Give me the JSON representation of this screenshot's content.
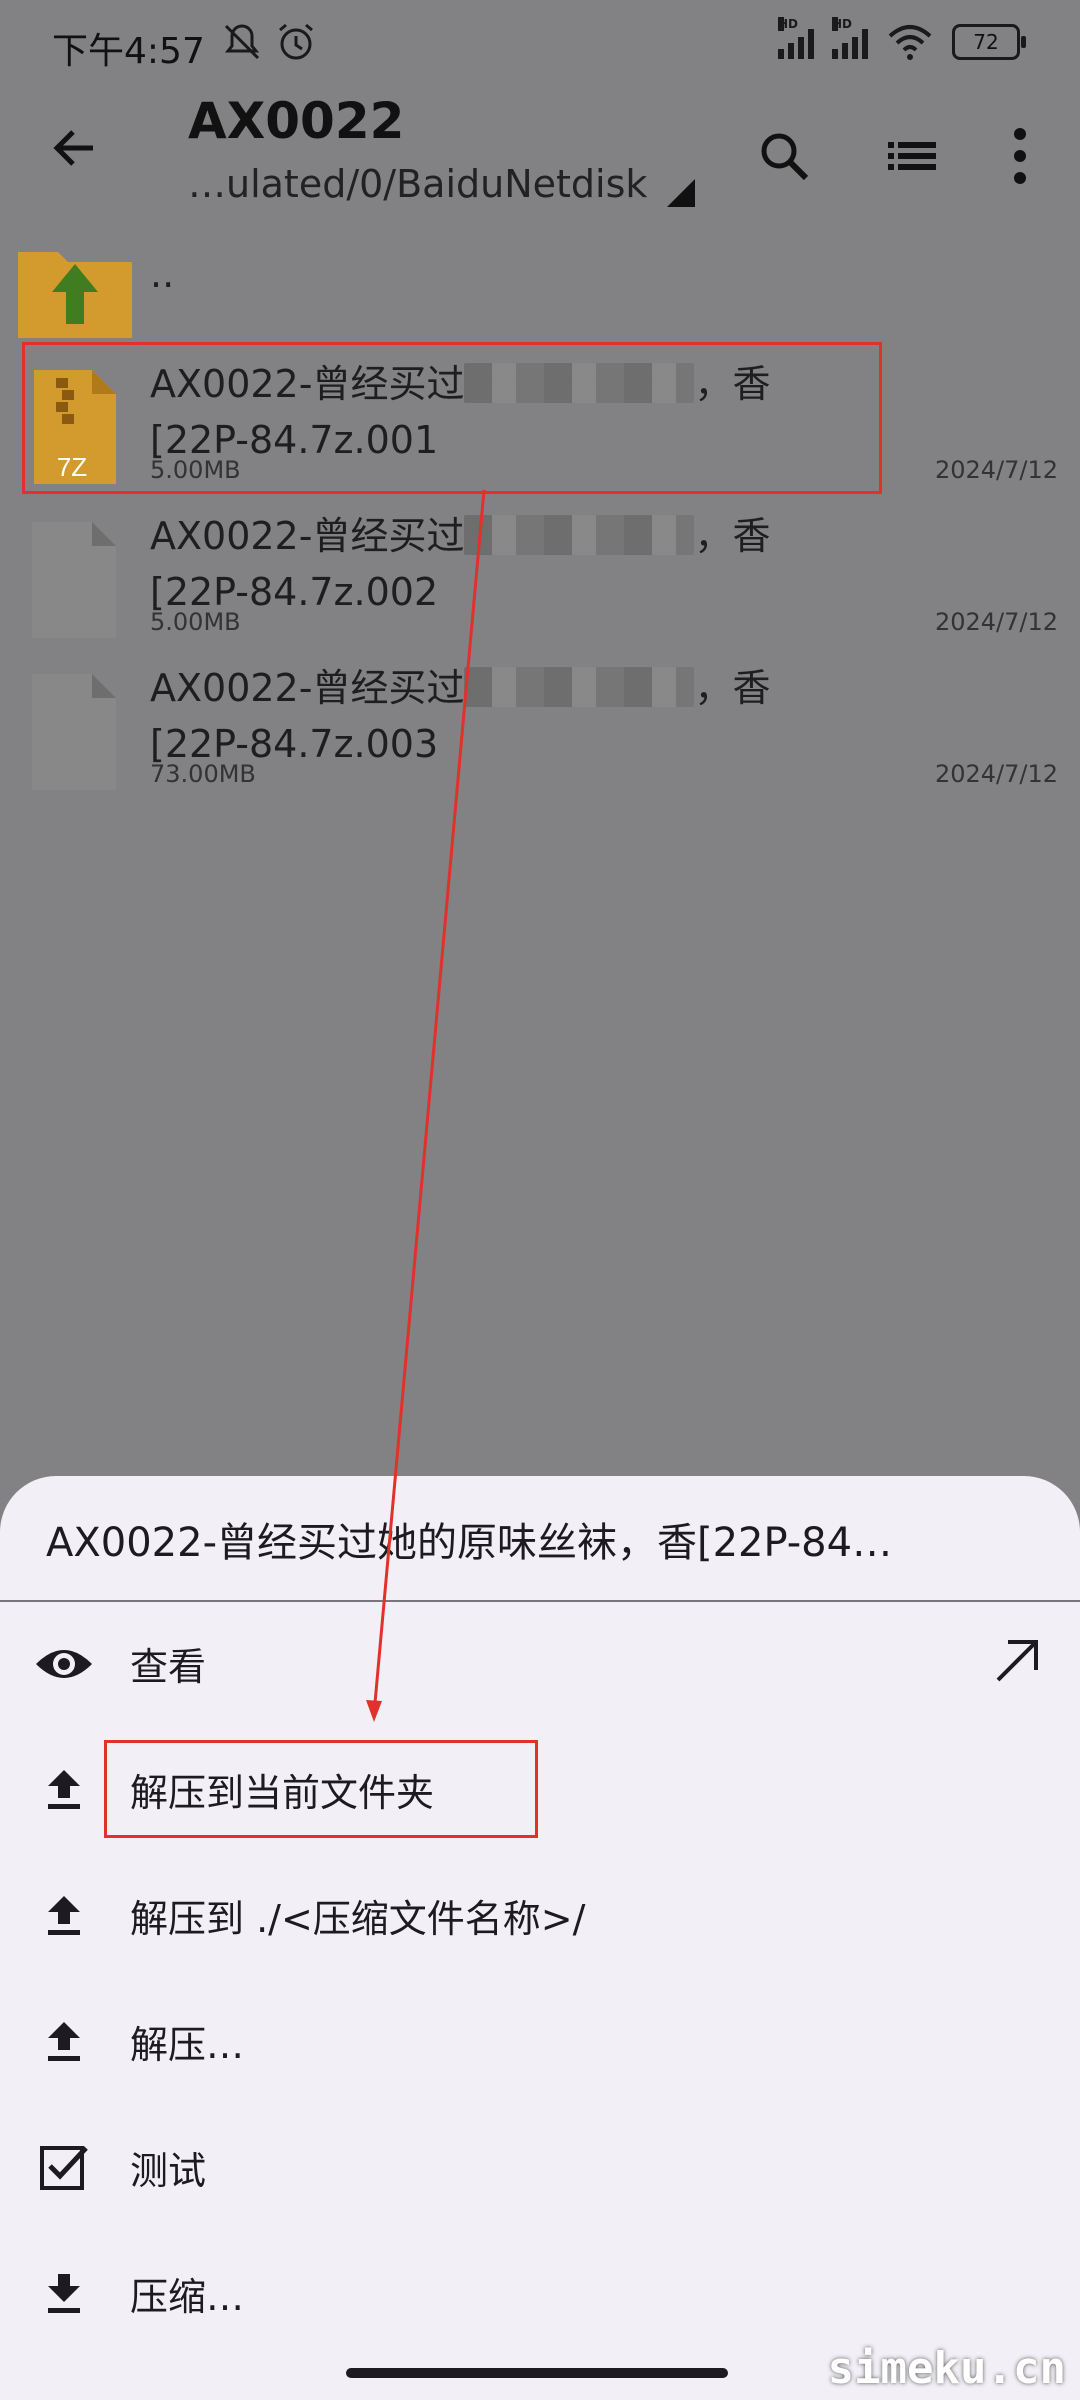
{
  "status_bar": {
    "time": "下午4:57",
    "battery": "72",
    "hd1": "HD",
    "hd2": "HD"
  },
  "app_bar": {
    "title": "AX0022",
    "path": "…ulated/0/BaiduNetdisk"
  },
  "files": [
    {
      "name": "..",
      "size": "",
      "date": ""
    },
    {
      "name_prefix": "AX0022-曾经买过",
      "name_suffix": "，香",
      "name_line2": "[22P-84.7z.001",
      "size": "5.00MB",
      "date": "2024/7/12"
    },
    {
      "name_prefix": "AX0022-曾经买过",
      "name_suffix": "，香",
      "name_line2": "[22P-84.7z.002",
      "size": "5.00MB",
      "date": "2024/7/12"
    },
    {
      "name_prefix": "AX0022-曾经买过",
      "name_suffix": "，香",
      "name_line2": "[22P-84.7z.003",
      "size": "73.00MB",
      "date": "2024/7/12"
    }
  ],
  "archive_icon_label": "7Z",
  "sheet": {
    "title": "AX0022-曾经买过她的原味丝袜，香[22P-84…",
    "items": [
      {
        "label": "查看",
        "icon": "eye-icon"
      },
      {
        "label": "解压到当前文件夹",
        "icon": "upload-icon"
      },
      {
        "label": "解压到 ./<压缩文件名称>/",
        "icon": "upload-icon"
      },
      {
        "label": "解压…",
        "icon": "upload-icon"
      },
      {
        "label": "测试",
        "icon": "checkbox-icon"
      },
      {
        "label": "压缩…",
        "icon": "download-icon"
      }
    ]
  },
  "watermark": "simeku.cn",
  "colors": {
    "overlay": "#828183",
    "sheet": "#f2eff6",
    "highlight": "#e0312b",
    "folder": "#d39a2e",
    "arrow_green": "#3f7d20"
  }
}
